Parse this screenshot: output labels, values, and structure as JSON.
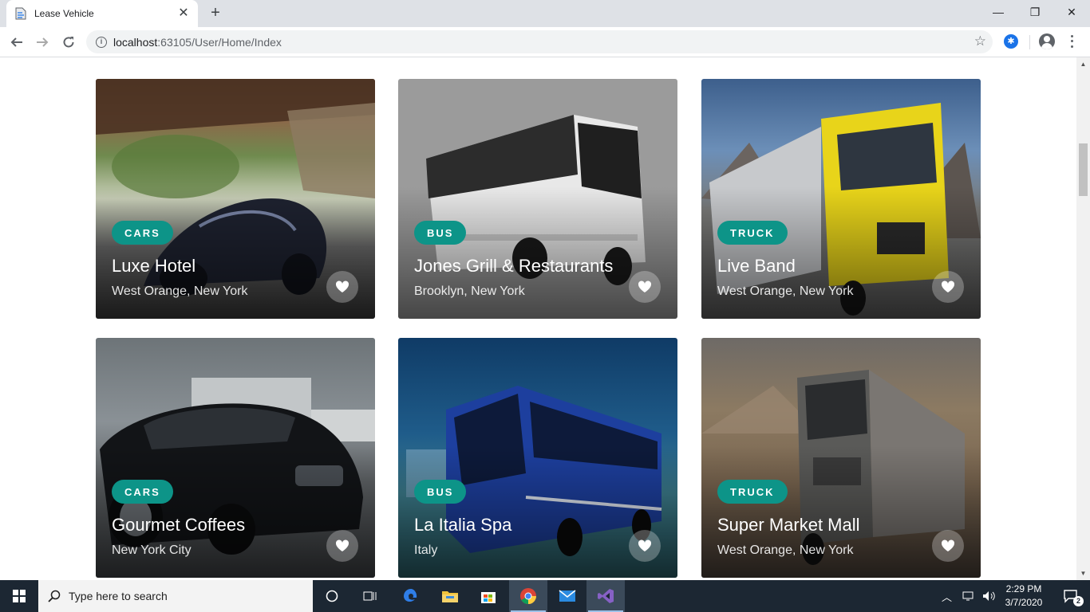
{
  "browser": {
    "tab_title": "Lease Vehicle",
    "tab_close": "✕",
    "new_tab": "+",
    "url_host": "localhost",
    "url_path": ":63105/User/Home/Index",
    "window_minimize": "—",
    "window_restore": "❐",
    "window_close": "✕"
  },
  "cards": [
    {
      "category": "CARS",
      "title": "Luxe Hotel",
      "location": "West Orange, New York"
    },
    {
      "category": "BUS",
      "title": "Jones Grill & Restaurants",
      "location": "Brooklyn, New York"
    },
    {
      "category": "TRUCK",
      "title": "Live Band",
      "location": "West Orange, New York"
    },
    {
      "category": "CARS",
      "title": "Gourmet Coffees",
      "location": "New York City"
    },
    {
      "category": "BUS",
      "title": "La Italia Spa",
      "location": "Italy"
    },
    {
      "category": "TRUCK",
      "title": "Super Market Mall",
      "location": "West Orange, New York"
    }
  ],
  "colors": {
    "badge": "#0d9488",
    "taskbar": "#1c2733"
  },
  "taskbar": {
    "search_placeholder": "Type here to search",
    "time": "2:29 PM",
    "date": "3/7/2020",
    "notification_count": "2"
  }
}
